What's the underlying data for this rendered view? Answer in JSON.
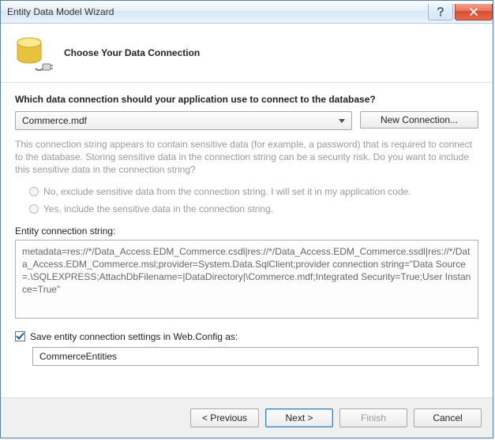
{
  "window": {
    "title": "Entity Data Model Wizard"
  },
  "header": {
    "title": "Choose Your Data Connection"
  },
  "question": "Which data connection should your application use to connect to the database?",
  "connection": {
    "selected": "Commerce.mdf",
    "new_button": "New Connection..."
  },
  "sensitive": {
    "info": "This connection string appears to contain sensitive data (for example, a password) that is required to connect to the database. Storing sensitive data in the connection string can be a security risk. Do you want to include this sensitive data in the connection string?",
    "exclude_label": "No, exclude sensitive data from the connection string. I will set it in my application code.",
    "include_label": "Yes, include the sensitive data in the connection string."
  },
  "entity_conn": {
    "label": "Entity connection string:",
    "value": "metadata=res://*/Data_Access.EDM_Commerce.csdl|res://*/Data_Access.EDM_Commerce.ssdl|res://*/Data_Access.EDM_Commerce.msl;provider=System.Data.SqlClient;provider connection string=\"Data Source=.\\SQLEXPRESS;AttachDbFilename=|DataDirectory|\\Commerce.mdf;Integrated Security=True;User Instance=True\""
  },
  "save": {
    "checkbox_label": "Save entity connection settings in Web.Config as:",
    "value": "CommerceEntities",
    "checked": true
  },
  "footer": {
    "previous": "< Previous",
    "next": "Next >",
    "finish": "Finish",
    "cancel": "Cancel"
  }
}
